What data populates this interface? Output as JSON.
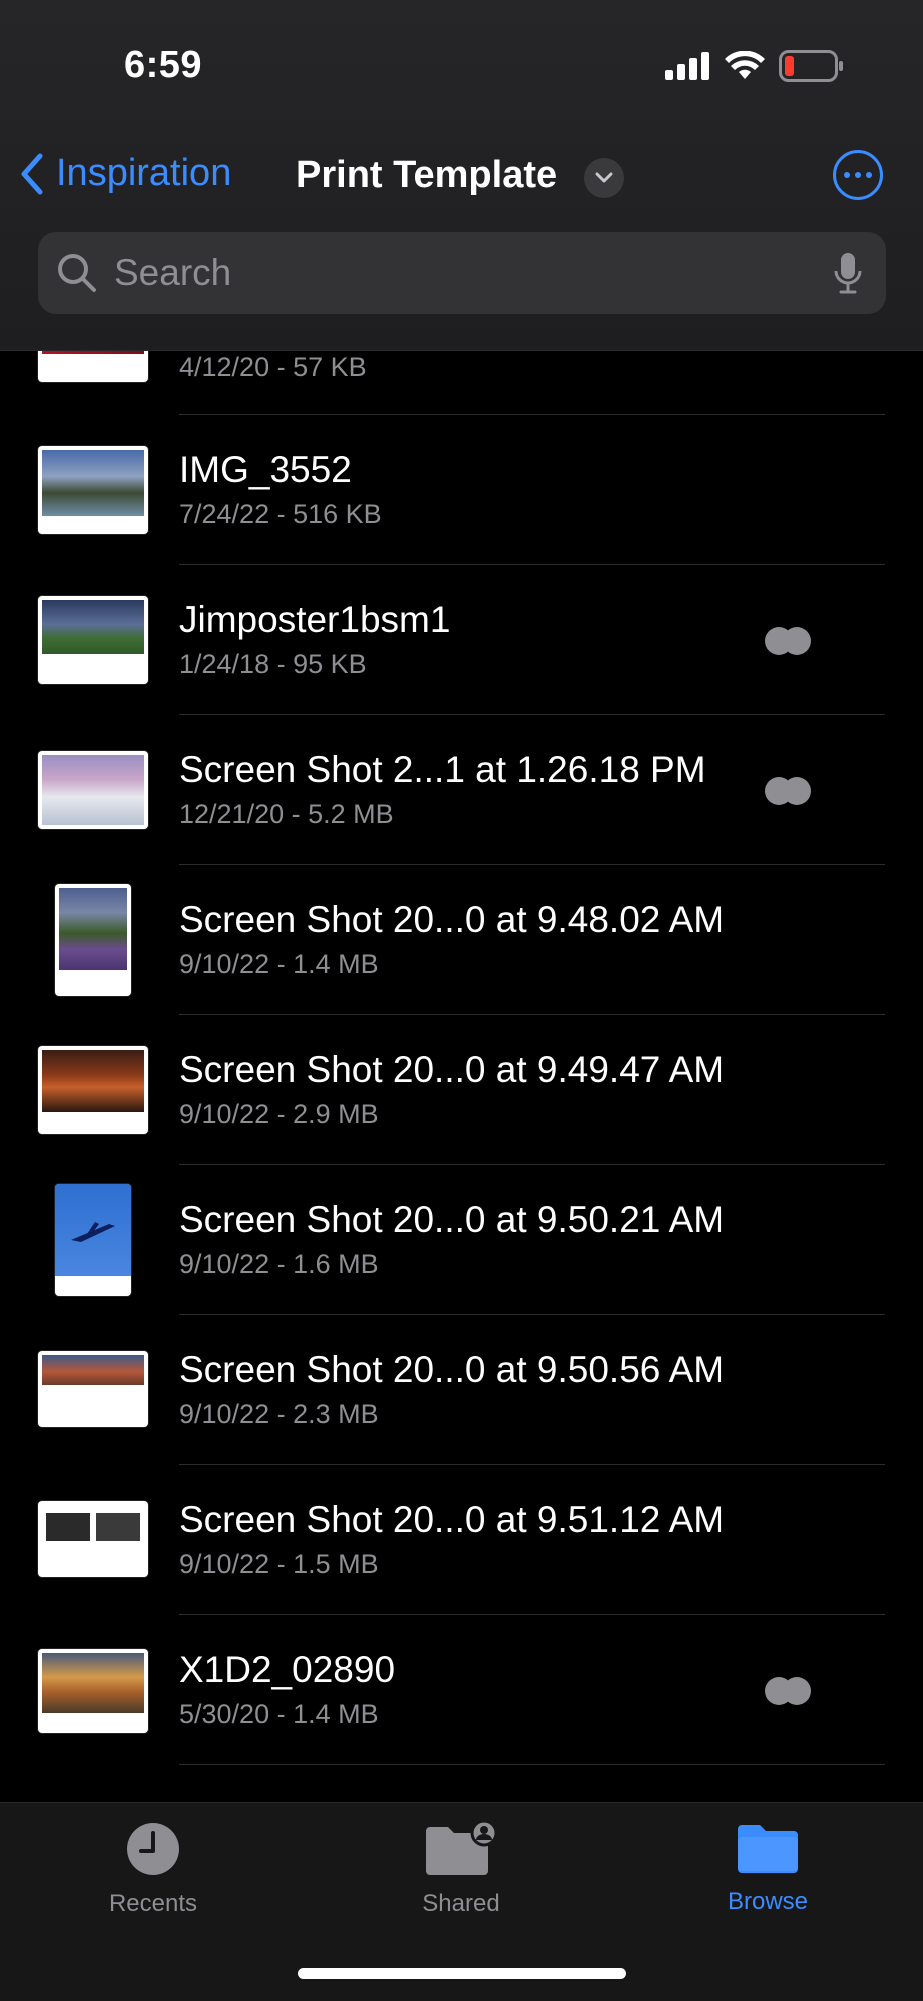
{
  "status_bar": {
    "time": "6:59"
  },
  "nav": {
    "back_label": "Inspiration",
    "title": "Print Template"
  },
  "search": {
    "placeholder": "Search"
  },
  "files": [
    {
      "name": "",
      "meta": "4/12/20 - 57 KB",
      "tagged": true
    },
    {
      "name": "IMG_3552",
      "meta": "7/24/22 - 516 KB",
      "tagged": false
    },
    {
      "name": "Jimposter1bsm1",
      "meta": "1/24/18 - 95 KB",
      "tagged": true
    },
    {
      "name": "Screen Shot 2...1 at 1.26.18 PM",
      "meta": "12/21/20 - 5.2 MB",
      "tagged": true
    },
    {
      "name": "Screen Shot 20...0 at 9.48.02 AM",
      "meta": "9/10/22 - 1.4 MB",
      "tagged": false
    },
    {
      "name": "Screen Shot 20...0 at 9.49.47 AM",
      "meta": "9/10/22 - 2.9 MB",
      "tagged": false
    },
    {
      "name": "Screen Shot 20...0 at 9.50.21 AM",
      "meta": "9/10/22 - 1.6 MB",
      "tagged": false
    },
    {
      "name": "Screen Shot 20...0 at 9.50.56 AM",
      "meta": "9/10/22 - 2.3 MB",
      "tagged": false
    },
    {
      "name": "Screen Shot 20...0 at 9.51.12 AM",
      "meta": "9/10/22 - 1.5 MB",
      "tagged": false
    },
    {
      "name": "X1D2_02890",
      "meta": "5/30/20 - 1.4 MB",
      "tagged": true
    }
  ],
  "tabbar": {
    "recents": "Recents",
    "shared": "Shared",
    "browse": "Browse",
    "active_color": "#3a8cff",
    "inactive_color": "#8e8e93"
  },
  "colors": {
    "accent": "#3a8cff",
    "battery_low": "#ff3b30"
  }
}
